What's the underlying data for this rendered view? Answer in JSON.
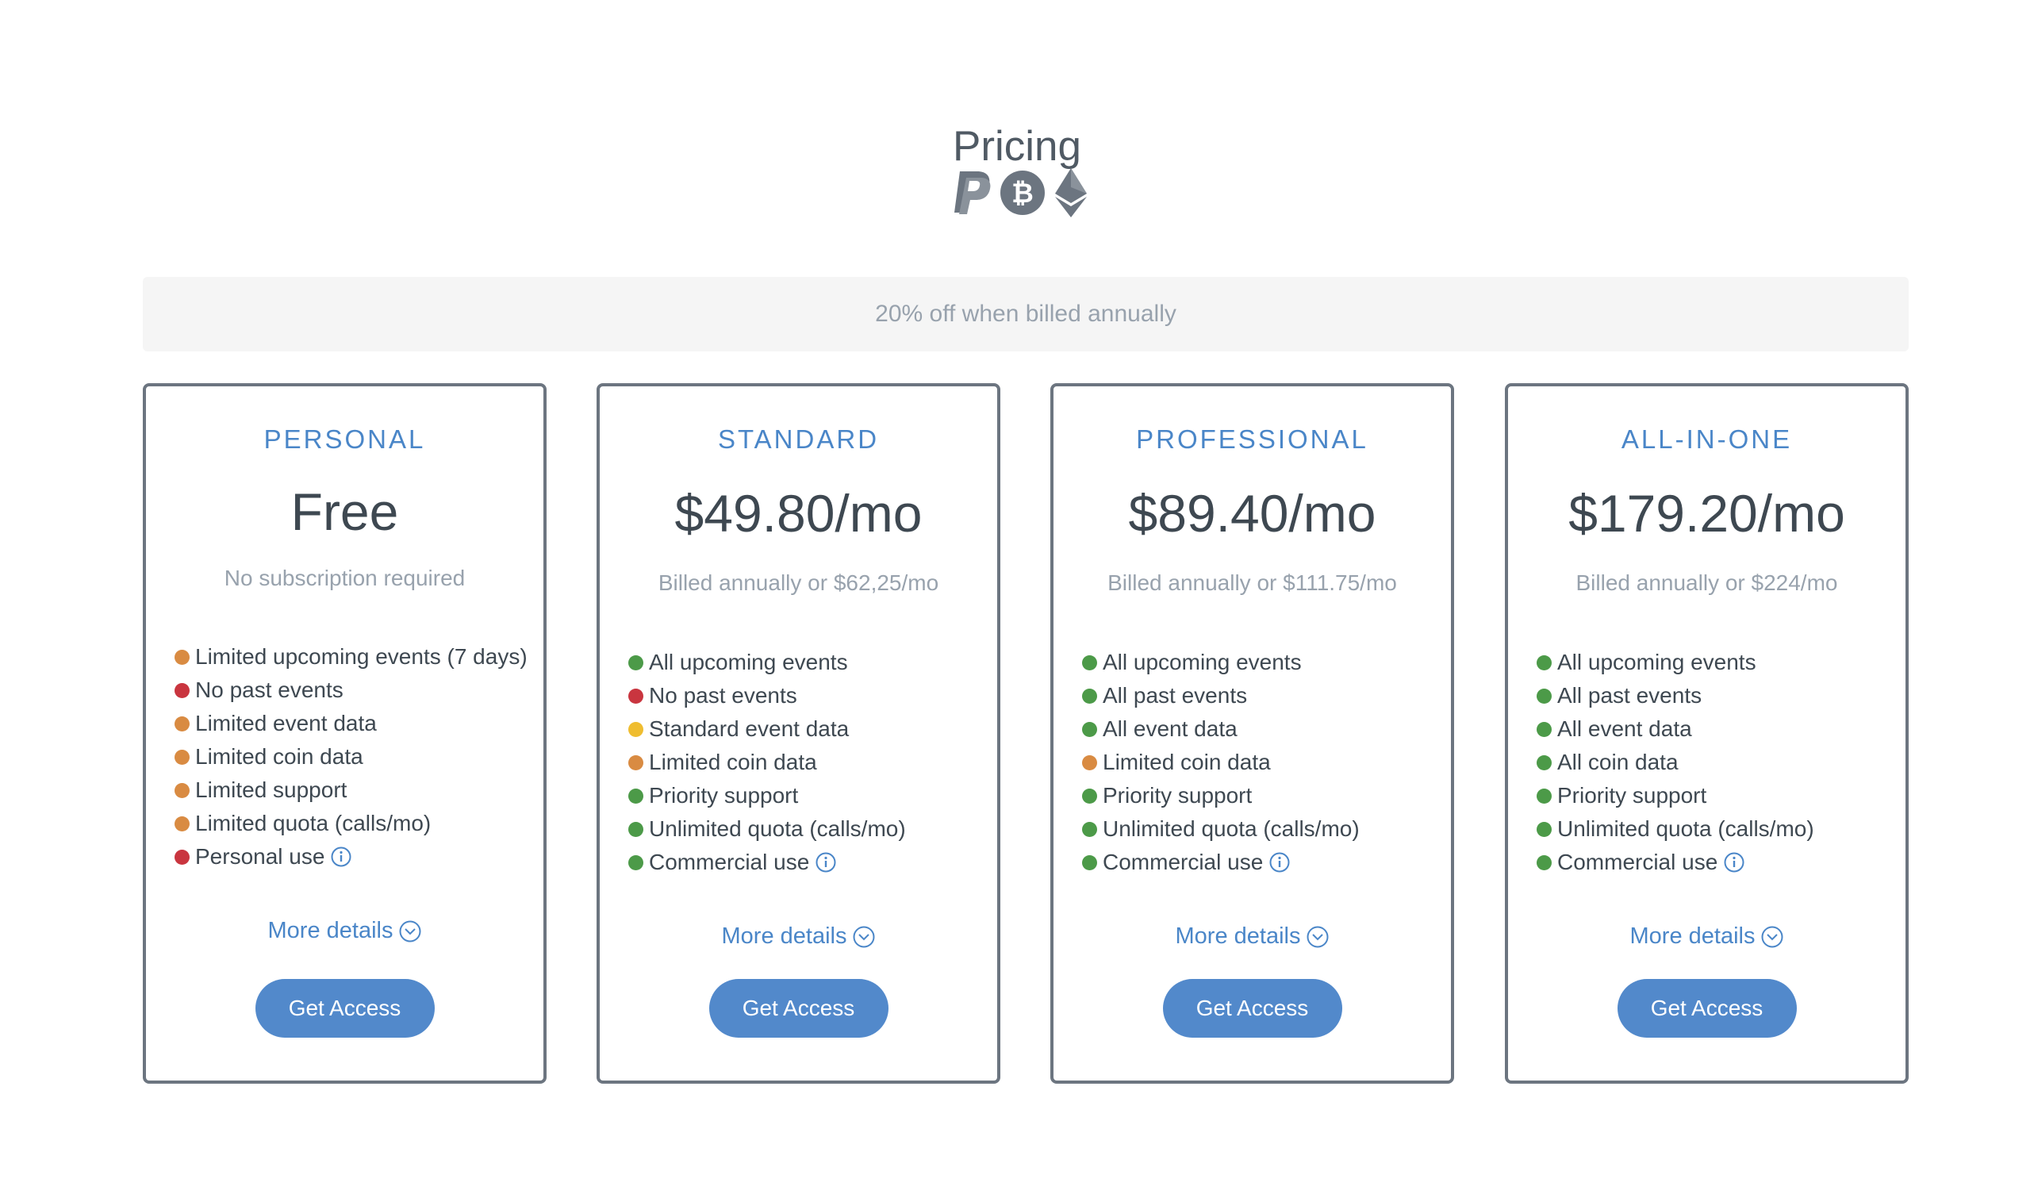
{
  "header": {
    "title": "Pricing",
    "payment_icons": [
      "paypal-icon",
      "bitcoin-icon",
      "ethereum-icon"
    ]
  },
  "annual_banner": "20% off when billed annually",
  "colors": {
    "accent": "#4a86c8",
    "button": "#5289cb",
    "status_green": "#4c9a48",
    "status_red": "#c9353f",
    "status_orange": "#d98b42",
    "status_yellow": "#efbd30"
  },
  "plans": [
    {
      "name": "PERSONAL",
      "price": "Free",
      "billing": "No subscription required",
      "features": [
        {
          "label": "Limited upcoming events (7 days)",
          "status": "orange"
        },
        {
          "label": "No past events",
          "status": "red"
        },
        {
          "label": "Limited event data",
          "status": "orange"
        },
        {
          "label": "Limited coin data",
          "status": "orange"
        },
        {
          "label": "Limited support",
          "status": "orange"
        },
        {
          "label": "Limited quota (calls/mo)",
          "status": "orange"
        },
        {
          "label": "Personal use",
          "status": "red",
          "info": true
        }
      ],
      "more_details": "More details",
      "button": "Get Access"
    },
    {
      "name": "STANDARD",
      "price": "$49.80/mo",
      "billing": "Billed annually or $62,25/mo",
      "features": [
        {
          "label": "All upcoming events",
          "status": "green"
        },
        {
          "label": "No past events",
          "status": "red"
        },
        {
          "label": "Standard event data",
          "status": "yellow"
        },
        {
          "label": "Limited coin data",
          "status": "orange"
        },
        {
          "label": "Priority support",
          "status": "green"
        },
        {
          "label": "Unlimited quota (calls/mo)",
          "status": "green"
        },
        {
          "label": "Commercial use",
          "status": "green",
          "info": true
        }
      ],
      "more_details": "More details",
      "button": "Get Access"
    },
    {
      "name": "PROFESSIONAL",
      "price": "$89.40/mo",
      "billing": "Billed annually or $111.75/mo",
      "features": [
        {
          "label": "All upcoming events",
          "status": "green"
        },
        {
          "label": "All past events",
          "status": "green"
        },
        {
          "label": "All event data",
          "status": "green"
        },
        {
          "label": "Limited coin data",
          "status": "orange"
        },
        {
          "label": "Priority support",
          "status": "green"
        },
        {
          "label": "Unlimited quota (calls/mo)",
          "status": "green"
        },
        {
          "label": "Commercial use",
          "status": "green",
          "info": true
        }
      ],
      "more_details": "More details",
      "button": "Get Access"
    },
    {
      "name": "ALL-IN-ONE",
      "price": "$179.20/mo",
      "billing": "Billed annually or $224/mo",
      "features": [
        {
          "label": "All upcoming events",
          "status": "green"
        },
        {
          "label": "All past events",
          "status": "green"
        },
        {
          "label": "All event data",
          "status": "green"
        },
        {
          "label": "All coin data",
          "status": "green"
        },
        {
          "label": "Priority support",
          "status": "green"
        },
        {
          "label": "Unlimited quota (calls/mo)",
          "status": "green"
        },
        {
          "label": "Commercial use",
          "status": "green",
          "info": true
        }
      ],
      "more_details": "More details",
      "button": "Get Access"
    }
  ]
}
